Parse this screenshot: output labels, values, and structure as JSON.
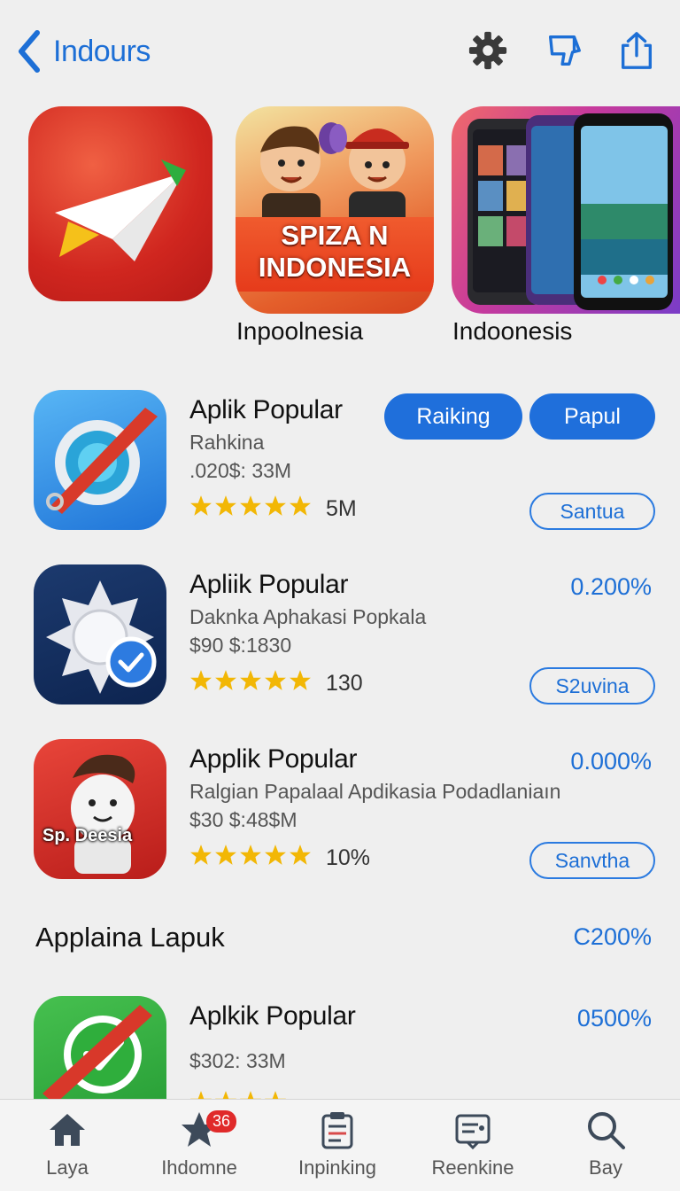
{
  "header": {
    "back_label": "Indours",
    "icons": [
      "gear-icon",
      "thumbs-down-icon",
      "share-icon"
    ]
  },
  "featured": {
    "tiles": [
      {
        "label": "",
        "icon": "paper-plane-icon"
      },
      {
        "label": "Inpoolnesia",
        "overlay_text": "SPIZA N\nINDONESIA"
      },
      {
        "label": "Indoonesis"
      }
    ]
  },
  "apps": [
    {
      "title": "Aplik Popular",
      "subtitle": "Rahkina",
      "price": ".020$: 33M",
      "rating_count": "5M",
      "pct": "",
      "action": "Santua",
      "pills": [
        "Raiking",
        "Papul"
      ],
      "icon": "compass-pen-icon"
    },
    {
      "title": "Apliik Popular",
      "subtitle": "Daknka Aphakasi Popkala",
      "price": "$90 $:1830",
      "rating_count": "130",
      "pct": "0.200%",
      "action": "S2uvina",
      "icon": "safari-check-icon"
    },
    {
      "title": "Applik Popular",
      "subtitle": "Ralgian Papalaal Apdikasia Podadlaniaın",
      "price": "$30 $:48$M",
      "rating_count": "10%",
      "pct": "0.000%",
      "action": "Sanvtha",
      "icon": "mascot-icon",
      "icon_text": "Sp. Deesia"
    }
  ],
  "section": {
    "title": "Applaina Lapuk",
    "pct": "C200%"
  },
  "app_bottom": {
    "title": "Aplkik Popular",
    "price": "$302: 33M",
    "pct": "0500%",
    "icon": "green-check-icon"
  },
  "tabbar": {
    "tabs": [
      {
        "label": "Laya",
        "icon": "home-icon"
      },
      {
        "label": "Ihdomne",
        "icon": "star-icon",
        "badge": "36"
      },
      {
        "label": "Inpinking",
        "icon": "clipboard-icon"
      },
      {
        "label": "Reenkine",
        "icon": "receipt-icon"
      },
      {
        "label": "Bay",
        "icon": "search-icon"
      }
    ]
  },
  "colors": {
    "accent": "#1d6fd6",
    "star": "#f2b705",
    "badge": "#e02a2a"
  }
}
